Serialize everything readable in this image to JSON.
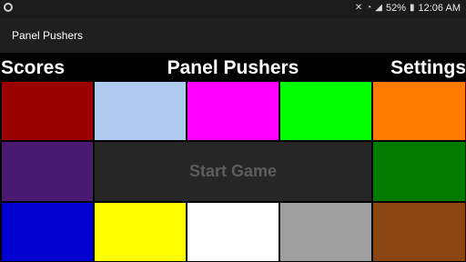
{
  "status_bar": {
    "left_icon": "camera-circle-icon",
    "icons": [
      "mute-icon",
      "wifi-icon",
      "signal-icon",
      "battery-icon"
    ],
    "battery": "52%",
    "time": "12:06 AM"
  },
  "app": {
    "title": "Panel Pushers"
  },
  "nav": {
    "scores_label": "Scores",
    "title": "Panel Pushers",
    "settings_label": "Settings"
  },
  "board": {
    "start_label": "Start Game",
    "panels": [
      {
        "name": "panel-dark-red",
        "color": "#9b0000"
      },
      {
        "name": "panel-light-blue",
        "color": "#aecbef"
      },
      {
        "name": "panel-magenta",
        "color": "#ff00ff"
      },
      {
        "name": "panel-green",
        "color": "#00ff00"
      },
      {
        "name": "panel-orange",
        "color": "#ff7a00"
      },
      {
        "name": "panel-purple",
        "color": "#4a1a73"
      },
      {
        "name": "panel-dark-green",
        "color": "#007b00"
      },
      {
        "name": "panel-blue",
        "color": "#0000d0"
      },
      {
        "name": "panel-yellow",
        "color": "#ffff00"
      },
      {
        "name": "panel-white",
        "color": "#ffffff"
      },
      {
        "name": "panel-gray",
        "color": "#a0a0a0"
      },
      {
        "name": "panel-brown",
        "color": "#8a4513"
      }
    ]
  }
}
